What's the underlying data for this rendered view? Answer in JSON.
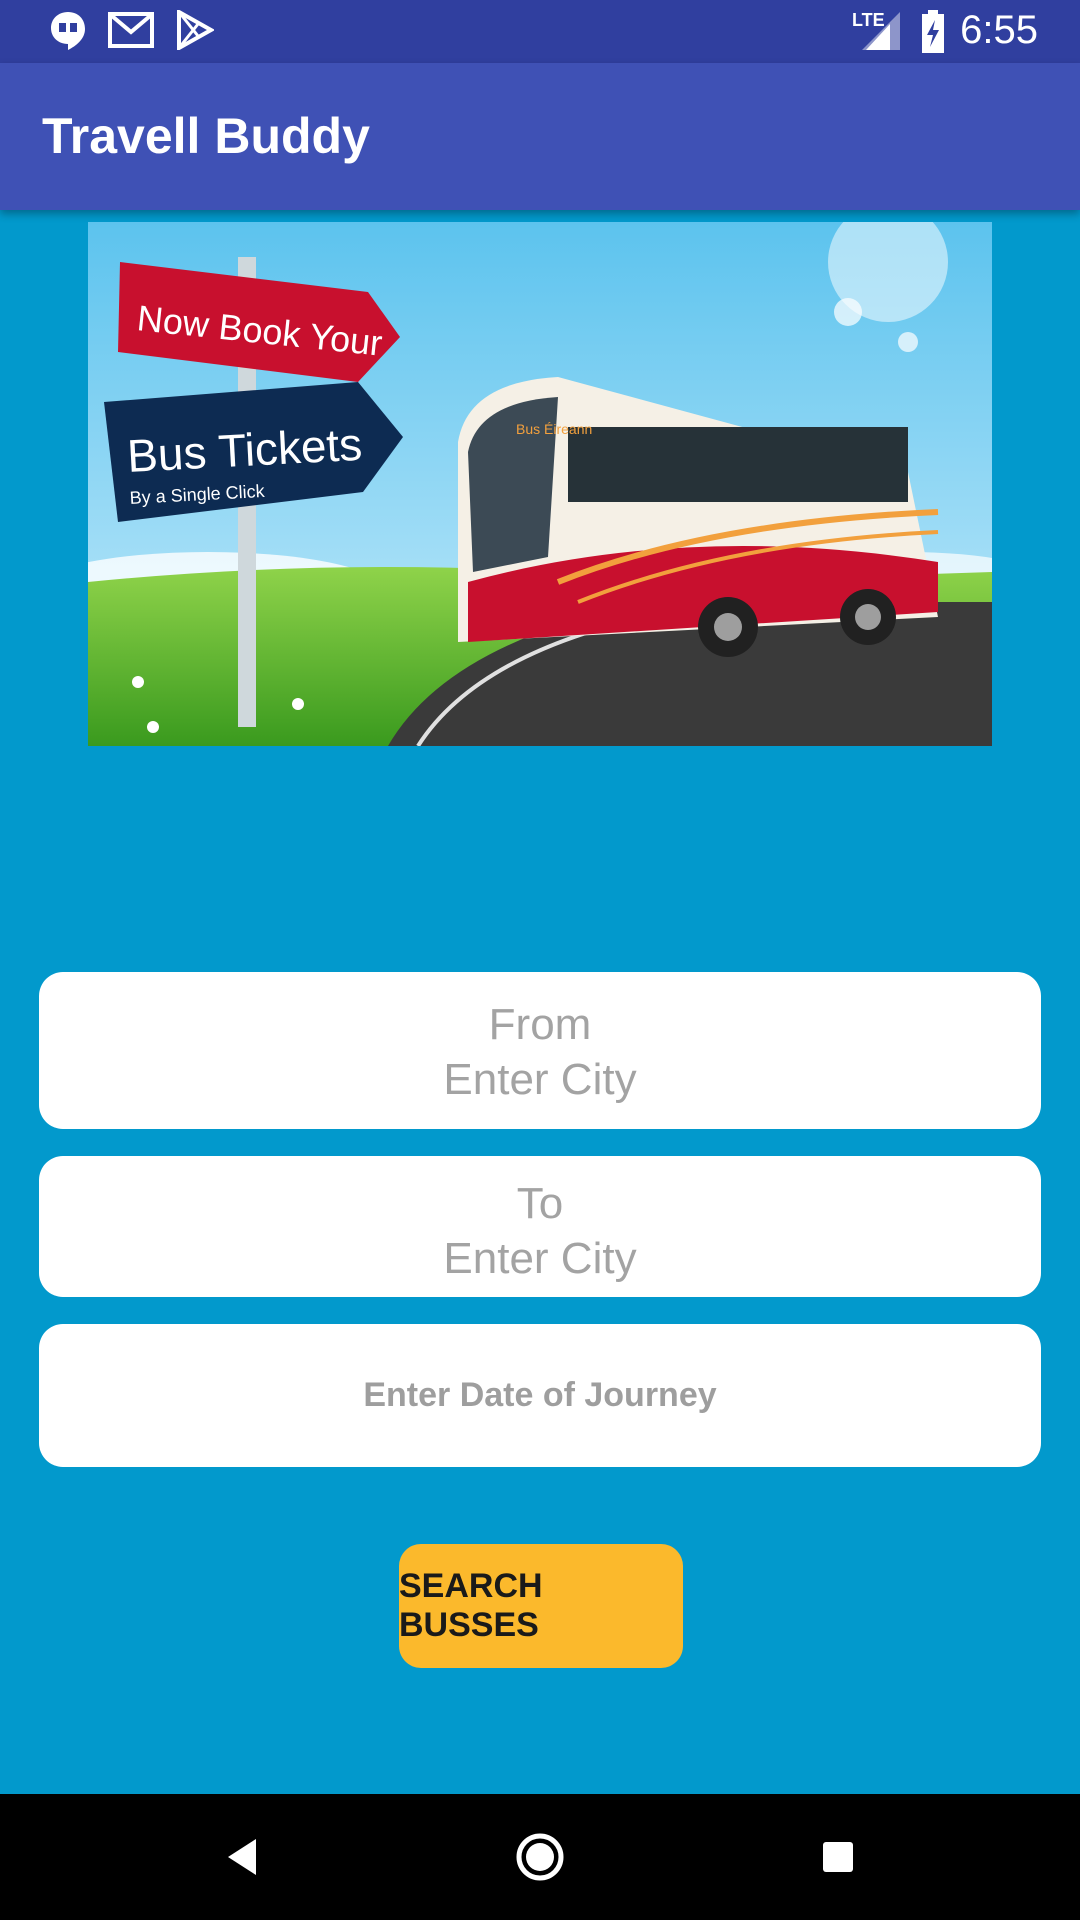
{
  "status_bar": {
    "time": "6:55",
    "network": "LTE",
    "icons": [
      "hangouts-icon",
      "gmail-icon",
      "play-store-icon",
      "signal-icon",
      "battery-icon"
    ]
  },
  "app_bar": {
    "title": "Travell Buddy"
  },
  "banner": {
    "sign_top": "Now Book Your",
    "sign_bottom": "Bus Tickets",
    "sign_sub": "By a Single Click",
    "bus_brand": "Bus Éireann"
  },
  "form": {
    "from_label": "From",
    "from_hint": "Enter City",
    "to_label": "To",
    "to_hint": "Enter City",
    "date_hint": "Enter Date of Journey",
    "search_label": "SEARCH BUSSES"
  },
  "colors": {
    "status_bar": "#303f9f",
    "app_bar": "#3f51b5",
    "background": "#0299cc",
    "button": "#fbb92c"
  },
  "nav_bar": {
    "icons": [
      "back-icon",
      "home-icon",
      "recents-icon"
    ]
  }
}
